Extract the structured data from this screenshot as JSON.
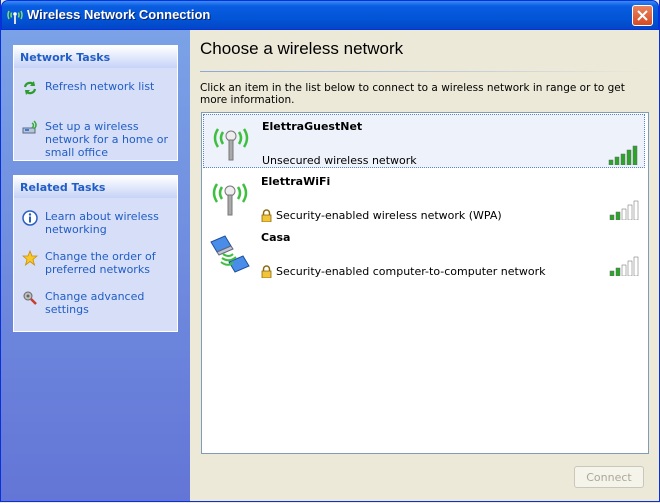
{
  "window": {
    "title": "Wireless Network Connection"
  },
  "sidebar": {
    "network_tasks": {
      "header": "Network Tasks",
      "items": [
        {
          "label": "Refresh network list",
          "icon": "refresh-icon"
        },
        {
          "label": "Set up a wireless network for a home or small office",
          "icon": "setup-network-icon"
        }
      ]
    },
    "related_tasks": {
      "header": "Related Tasks",
      "items": [
        {
          "label": "Learn about wireless networking",
          "icon": "info-icon"
        },
        {
          "label": "Change the order of preferred networks",
          "icon": "star-icon"
        },
        {
          "label": "Change advanced settings",
          "icon": "settings-icon"
        }
      ]
    }
  },
  "main": {
    "title": "Choose a wireless network",
    "instructions": "Click an item in the list below to connect to a wireless network in range or to get more information.",
    "networks": [
      {
        "name": "ElettraGuestNet",
        "status": "Unsecured wireless network",
        "secured": false,
        "signal_bars": 5,
        "selected": true,
        "icon": "antenna-icon"
      },
      {
        "name": "ElettraWiFi",
        "status": "Security-enabled wireless network (WPA)",
        "secured": true,
        "signal_bars": 2,
        "selected": false,
        "icon": "antenna-icon"
      },
      {
        "name": "Casa",
        "status": "Security-enabled computer-to-computer network",
        "secured": true,
        "signal_bars": 2,
        "selected": false,
        "icon": "computer-to-computer-icon"
      }
    ],
    "connect_label": "Connect"
  },
  "colors": {
    "link": "#215dc6",
    "signal_on": "#2aa52a",
    "signal_off": "#ffffff",
    "titlebar": "#0355d8"
  }
}
